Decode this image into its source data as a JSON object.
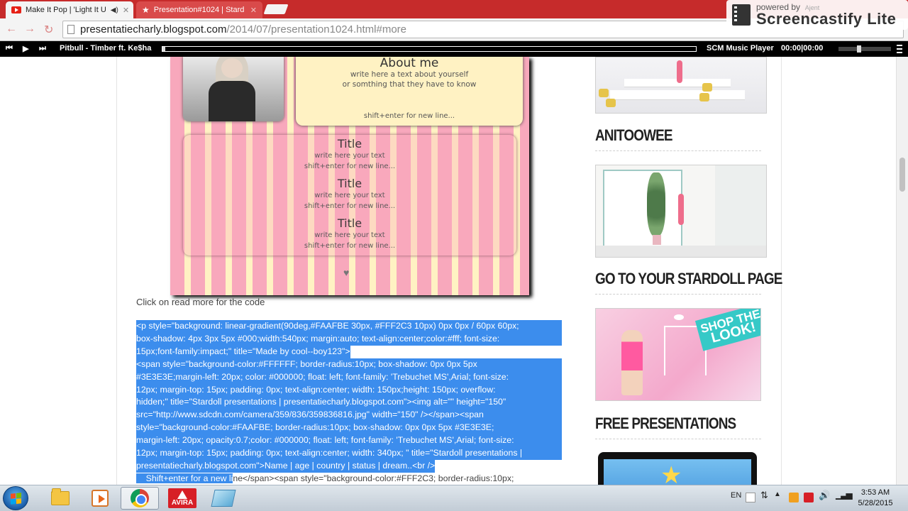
{
  "browser": {
    "tabs": [
      {
        "title": "Make It Pop | 'Light It U",
        "icon": "youtube-icon",
        "audio": "◀)",
        "close": "✕"
      },
      {
        "title": "Presentation#1024 | Stard",
        "icon": "star-icon",
        "close": "✕"
      }
    ],
    "url_host": "presentatiecharly.blogspot.com",
    "url_path": "/2014/07/presentation1024.html#more",
    "screencastify": {
      "powered": "powered by",
      "user": "Ajent",
      "brand": "Screencastify Lite"
    }
  },
  "player": {
    "track": "Pitbull - Timber ft. Ke$ha",
    "name": "SCM Music Player",
    "time": "00:00|00:00",
    "progress": 0.005
  },
  "presentation": {
    "about_title": "About me",
    "about_line1": "write here a text about yourself",
    "about_line2": "or somthing that they have to know",
    "about_foot": "shift+enter for new line...",
    "blocks": [
      {
        "title": "Title",
        "text": "write here your text",
        "hint": "shift+enter for new line..."
      },
      {
        "title": "Title",
        "text": "write here your text",
        "hint": "shift+enter for new line..."
      },
      {
        "title": "Title",
        "text": "write here your text",
        "hint": "shift+enter for new line..."
      }
    ],
    "heart": "♥"
  },
  "readmore": "Click on read more for the code",
  "code_lines": [
    {
      "text": "<p style=\"background: linear-gradient(90deg,#FAAFBE 30px, #FFF2C3 10px) 0px 0px / 60px 60px;",
      "sel": true
    },
    {
      "text": "box-shadow: 4px 3px 5px #000;width:540px; margin:auto; text-align:center;color:#fff; font-size:",
      "sel": true
    },
    {
      "text": "15px;font-family:impact;\" title=\"Made by cool--boy123\">",
      "sel": true,
      "short": true
    },
    {
      "text": "        <span style=\"background-color:#FFFFFF; border-radius:10px; box-shadow: 0px 0px 5px",
      "sel": true
    },
    {
      "text": "#3E3E3E;margin-left: 20px; color: #000000; float: left; font-family: 'Trebuchet MS',Arial; font-size:",
      "sel": true
    },
    {
      "text": "12px; margin-top: 15px; padding: 0px; text-align:center; width: 150px;height: 150px; overflow:",
      "sel": true
    },
    {
      "text": "hidden;\" title=\"Stardoll presentations | presentatiecharly.blogspot.com\"><img alt=\"\" height=\"150\"",
      "sel": true
    },
    {
      "text": "src=\"http://www.sdcdn.com/camera/359/836/359836816.jpg\" width=\"150\" /></span><span",
      "sel": true
    },
    {
      "text": "style=\"background-color:#FAAFBE; border-radius:10px; box-shadow: 0px 0px 5px #3E3E3E;",
      "sel": true
    },
    {
      "text": "margin-left: 20px; opacity:0.7;color: #000000; float: left; font-family: 'Trebuchet MS',Arial; font-size:",
      "sel": true
    },
    {
      "text": "12px; margin-top: 15px; padding: 0px; text-align:center; width: 340px; \" title=\"Stardoll presentations |",
      "sel": true
    },
    {
      "text": "presentatiecharly.blogspot.com\">Name | age | country | status | dream..<br />",
      "sel": true,
      "short": true
    }
  ],
  "code_last": {
    "sel": "    Shift+enter for a new li",
    "rest": "ne</span><span style=\"background-color:#FFF2C3; border-radius:10px;"
  },
  "sidebar": {
    "titles": [
      "ANITOOWEE",
      "GO TO YOUR STARDOLL PAGE",
      "FREE PRESENTATIONS"
    ],
    "shop_banner": [
      "SHOP THE",
      "LOOK!"
    ]
  },
  "taskbar": {
    "lang": "EN",
    "time": "3:53 AM",
    "date": "5/28/2015",
    "avira": "AVIRA"
  }
}
